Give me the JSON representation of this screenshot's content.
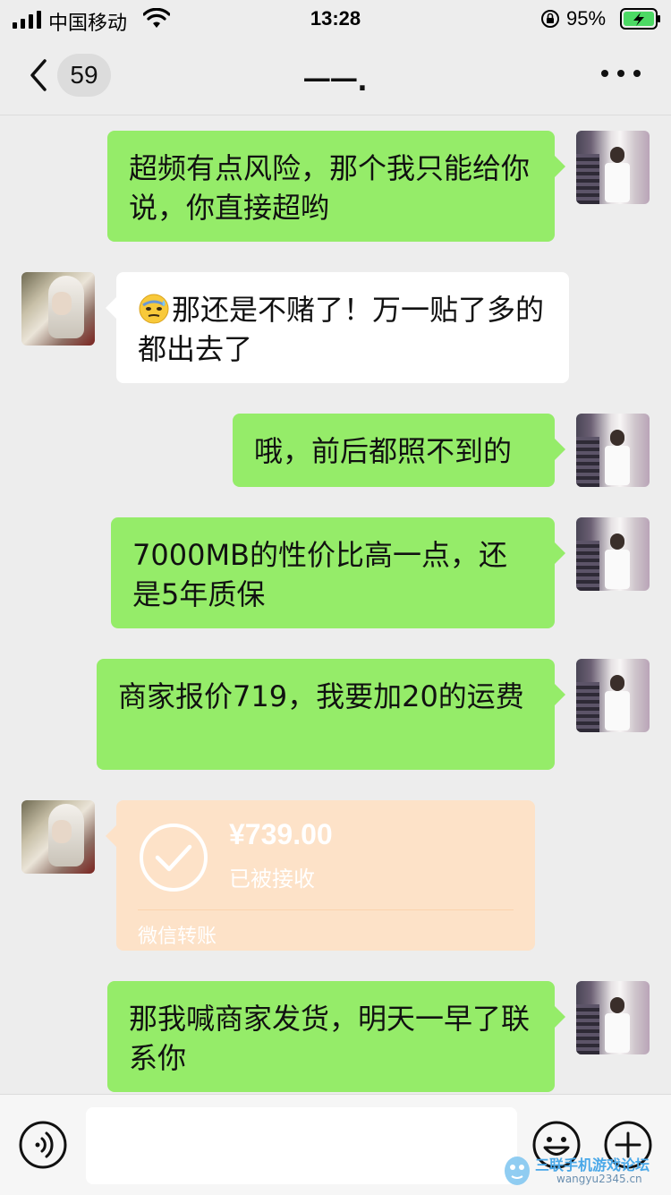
{
  "status_bar": {
    "carrier": "中国移动",
    "time": "13:28",
    "battery_percent": "95%"
  },
  "nav": {
    "unread_count": "59",
    "title": "一一."
  },
  "messages": [
    {
      "from": "me",
      "text": "超频有点风险，那个我只能给你说，你直接超哟"
    },
    {
      "from": "other",
      "text": "那还是不赌了！万一贴了多的都出去了",
      "emoji": "sweat-face-icon"
    },
    {
      "from": "me",
      "text": "哦，前后都照不到的"
    },
    {
      "from": "me",
      "text": "7000MB的性价比高一点，还是5年质保"
    },
    {
      "from": "me",
      "text": "商家报价719，我要加20的运费"
    },
    {
      "from": "other",
      "type": "transfer",
      "amount": "¥739.00",
      "status": "已被接收",
      "label": "微信转账"
    },
    {
      "from": "me",
      "text": "那我喊商家发货，明天一早了联系你"
    }
  ],
  "input": {
    "value": "",
    "placeholder": ""
  },
  "watermark": {
    "text": "三联手机游戏论坛",
    "url": "wangyu2345.cn"
  },
  "colors": {
    "background": "#ededed",
    "sent_bubble": "#95ec69",
    "received_bubble": "#ffffff",
    "transfer_card": "#fde2c8",
    "battery": "#4cd964"
  }
}
